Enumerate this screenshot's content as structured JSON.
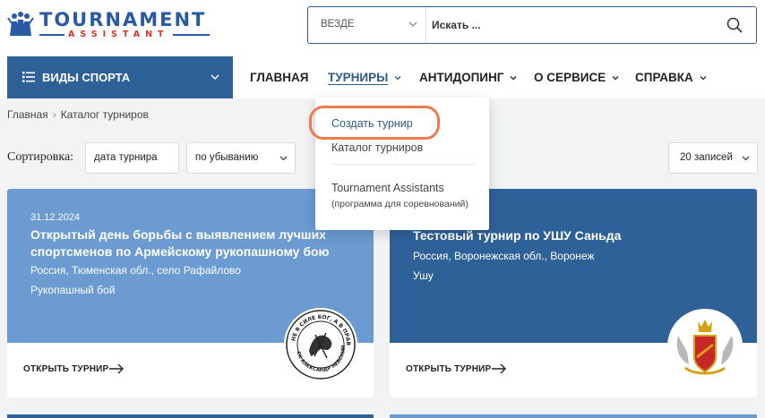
{
  "logo": {
    "title": "TOURNAMENT",
    "subtitle": "ASSISTANT",
    "icon": "people-trophy-icon",
    "colors": {
      "primary": "#2b5aa4",
      "accent": "#d9342b"
    }
  },
  "search": {
    "scope": "ВЕЗДЕ",
    "placeholder": "Искать ...",
    "button_icon": "search-icon"
  },
  "nav": {
    "sports_button": "ВИДЫ СПОРТА",
    "items": [
      {
        "label": "ГЛАВНАЯ",
        "has_dropdown": false
      },
      {
        "label": "ТУРНИРЫ",
        "has_dropdown": true,
        "active": true
      },
      {
        "label": "АНТИДОПИНГ",
        "has_dropdown": true
      },
      {
        "label": "О СЕРВИСЕ",
        "has_dropdown": true
      },
      {
        "label": "СПРАВКА",
        "has_dropdown": true
      }
    ]
  },
  "dropdown": {
    "items": [
      "Создать турнир",
      "Каталог турниров",
      "Tournament Assistants"
    ],
    "sub": "(программа для соревнований)"
  },
  "breadcrumb": {
    "home": "Главная",
    "current": "Каталог турниров"
  },
  "sort": {
    "label": "Сортировка:",
    "field": "дата турнира",
    "order": "по убыванию",
    "per_page": "20 записей"
  },
  "cards": [
    {
      "date": "31.12.2024",
      "title": "Открытый день борьбы с выявлением лучших спортсменов по Армейскому рукопашному бою",
      "location": "Россия, Тюменская обл., село Рафайлово",
      "sport": "Рукопашный бой",
      "open_label": "ОТКРЫТЬ ТУРНИР",
      "emblem": "club-seal-icon",
      "emblem_text_top": "НЕ В СИЛЕ БОГ, А В ПРАВДЕ",
      "emblem_text_bottom": "СК АЛЕКСАНДР НЕВСКИЙ",
      "color": "#6b9bd1"
    },
    {
      "date": "",
      "title": "Тестовый турнир по УШУ Саньда",
      "location": "Россия, Воронежская обл., Воронеж",
      "sport": "Ушу",
      "open_label": "ОТКРЫТЬ ТУРНИР",
      "emblem": "coat-of-arms-icon",
      "color": "#2f6199"
    }
  ]
}
